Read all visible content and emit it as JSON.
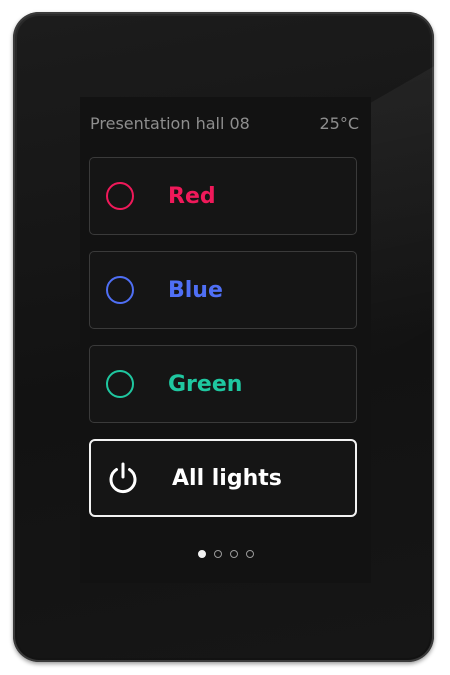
{
  "header": {
    "room": "Presentation hall 08",
    "temperature": "25°C"
  },
  "tiles": [
    {
      "label": "Red",
      "icon": "ring-icon",
      "color": "#f0195a"
    },
    {
      "label": "Blue",
      "icon": "ring-icon",
      "color": "#4f6ff5"
    },
    {
      "label": "Green",
      "icon": "ring-icon",
      "color": "#1fc7a0"
    },
    {
      "label": "All lights",
      "icon": "power-icon",
      "color": "#ffffff"
    }
  ],
  "pagination": {
    "current_page": 1,
    "total_pages": 4
  }
}
